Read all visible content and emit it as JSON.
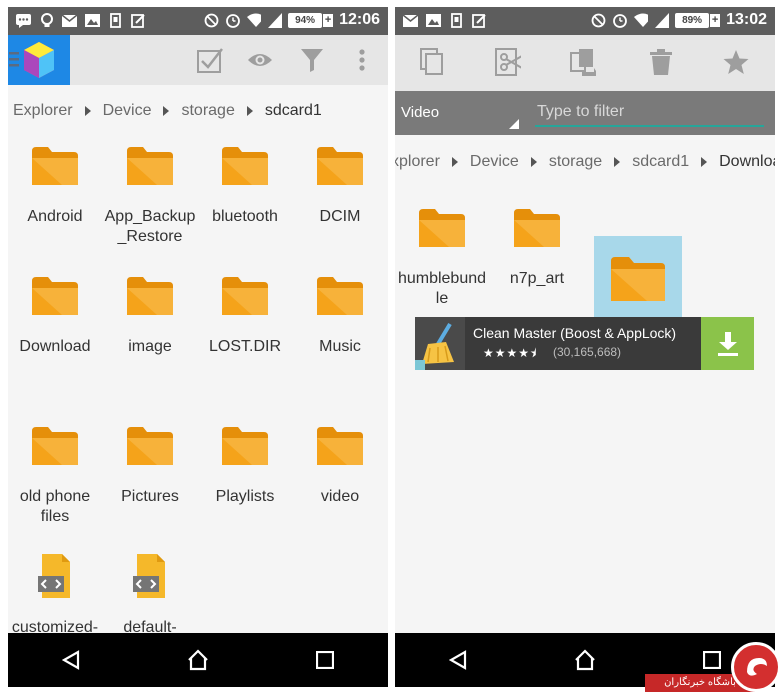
{
  "left_screen": {
    "status_bar": {
      "time": "12:06",
      "battery": "94%",
      "battery_charging": "+"
    },
    "toolbar": {
      "icons": [
        "app-logo-icon",
        "checkbox-select-icon",
        "eye-icon",
        "filter-funnel-icon",
        "overflow-menu-icon"
      ]
    },
    "breadcrumb": [
      "Explorer",
      "Device",
      "storage",
      "sdcard1"
    ],
    "items": [
      {
        "label": "Android",
        "kind": "folder"
      },
      {
        "label": "App_Backup\n_Restore",
        "kind": "folder"
      },
      {
        "label": "bluetooth",
        "kind": "folder"
      },
      {
        "label": "DCIM",
        "kind": "folder"
      },
      {
        "label": "Download",
        "kind": "folder"
      },
      {
        "label": "image",
        "kind": "folder"
      },
      {
        "label": "LOST.DIR",
        "kind": "folder"
      },
      {
        "label": "Music",
        "kind": "folder"
      },
      {
        "label": "old phone\nfiles",
        "kind": "folder"
      },
      {
        "label": "Pictures",
        "kind": "folder"
      },
      {
        "label": "Playlists",
        "kind": "folder"
      },
      {
        "label": "video",
        "kind": "folder"
      },
      {
        "label": "customized-",
        "kind": "code-file"
      },
      {
        "label": "default-",
        "kind": "code-file"
      }
    ]
  },
  "right_screen": {
    "status_bar": {
      "time": "13:02",
      "battery": "89%",
      "battery_charging": "+"
    },
    "action_bar": {
      "icons": [
        "copy-icon",
        "cut-icon",
        "move-icon",
        "trash-icon",
        "star-icon"
      ]
    },
    "filter": {
      "dropdown_value": "Video",
      "placeholder": "Type to filter"
    },
    "breadcrumb": [
      "xplorer",
      "Device",
      "storage",
      "sdcard1",
      "Download"
    ],
    "items": [
      {
        "label": "humblebund\nle",
        "kind": "folder"
      },
      {
        "label": "n7p_art",
        "kind": "folder"
      },
      {
        "label": "",
        "kind": "folder",
        "highlighted": true
      }
    ],
    "ad": {
      "title": "Clean Master (Boost & AppLock)",
      "stars": "★★★★⯨",
      "rating_count": "(30,165,668)"
    }
  },
  "watermark": {
    "text": "باشگاه خبرنگاران"
  },
  "colors": {
    "folder": "#f5a31a",
    "folder_dark": "#e58f0a",
    "accent": "#26a69a",
    "download_green": "#8bc34a",
    "highlight": "#a8d8ea"
  }
}
